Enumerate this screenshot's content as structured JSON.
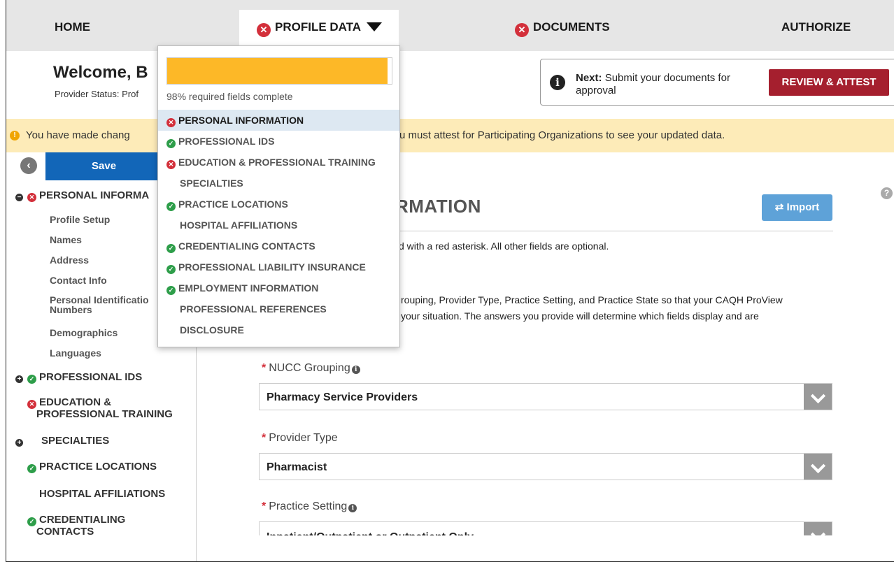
{
  "nav": {
    "home": "HOME",
    "profile_data": "PROFILE DATA",
    "documents": "DOCUMENTS",
    "authorize": "AUTHORIZE"
  },
  "header": {
    "welcome": "Welcome, B",
    "provider_status": "Provider Status: Prof"
  },
  "next_box": {
    "label": "Next:",
    "text": "Submit your documents for approval",
    "button": "REVIEW & ATTEST"
  },
  "alert": {
    "text_left": "You have made chang",
    "text_right": "u must attest for Participating Organizations to see your updated data."
  },
  "sidebar": {
    "save": "Save",
    "personal": "PERSONAL INFORMA",
    "sub_items": [
      "Profile Setup",
      "Names",
      "Address",
      "Contact Info",
      "Personal Identificatio",
      "Numbers",
      "Demographics",
      "Languages"
    ],
    "professional_ids": "PROFESSIONAL IDS",
    "education_1": "EDUCATION &",
    "education_2": "PROFESSIONAL TRAINING",
    "specialties": "SPECIALTIES",
    "practice_locations": "PRACTICE LOCATIONS",
    "hospital_affiliations": "HOSPITAL AFFILIATIONS",
    "credentialing_1": "CREDENTIALING",
    "credentialing_2": "CONTACTS"
  },
  "main": {
    "title": "RMATION",
    "import": "Import",
    "asterisk_note": "d with a red asterisk. All other fields are optional.",
    "intro_line1": "rouping, Provider Type, Practice Setting, and Practice State so that your CAQH ProView",
    "intro_line2": "your situation. The answers you provide will determine which fields display and are",
    "fields": [
      {
        "label": "NUCC Grouping",
        "value": "Pharmacy Service Providers"
      },
      {
        "label": "Provider Type",
        "value": "Pharmacist"
      },
      {
        "label": "Practice Setting",
        "value": "Inpatient/Outpatient or Outpatient Only"
      }
    ]
  },
  "dropdown": {
    "progress_percent": 98,
    "progress_text": "98% required fields complete",
    "items": [
      {
        "label": "PERSONAL INFORMATION",
        "status": "error"
      },
      {
        "label": "PROFESSIONAL IDS",
        "status": "ok"
      },
      {
        "label": "EDUCATION & PROFESSIONAL TRAINING",
        "status": "error"
      },
      {
        "label": "SPECIALTIES",
        "status": "none"
      },
      {
        "label": "PRACTICE LOCATIONS",
        "status": "ok"
      },
      {
        "label": "HOSPITAL AFFILIATIONS",
        "status": "none"
      },
      {
        "label": "CREDENTIALING CONTACTS",
        "status": "ok"
      },
      {
        "label": "PROFESSIONAL LIABILITY INSURANCE",
        "status": "ok"
      },
      {
        "label": "EMPLOYMENT INFORMATION",
        "status": "ok"
      },
      {
        "label": "PROFESSIONAL REFERENCES",
        "status": "none"
      },
      {
        "label": "DISCLOSURE",
        "status": "none"
      }
    ]
  },
  "colors": {
    "error": "#d3303b",
    "ok": "#2e9e4a",
    "progress": "#fdb827",
    "save": "#1266b8",
    "review": "#a51f2e",
    "alert_bg": "#fdebb8"
  }
}
